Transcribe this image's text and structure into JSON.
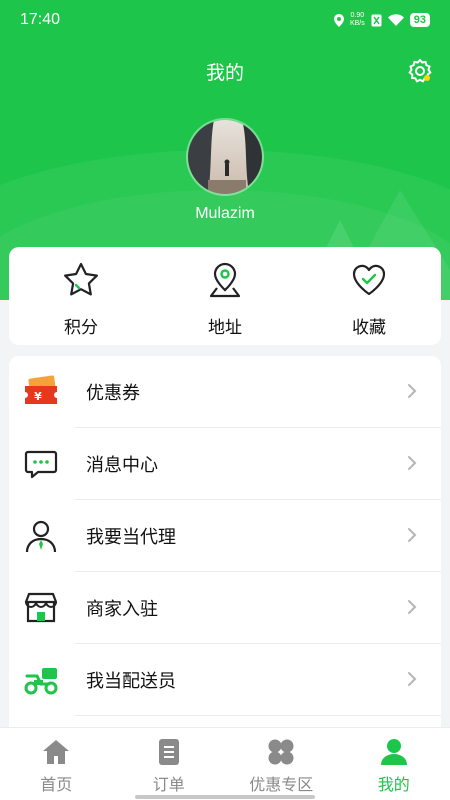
{
  "status_bar": {
    "time": "17:40",
    "net_speed_value": "0.90",
    "net_speed_unit": "KB/s",
    "battery": "93"
  },
  "header": {
    "title": "我的",
    "username": "Mulazim"
  },
  "quick_actions": [
    {
      "label": "积分",
      "icon": "star-icon"
    },
    {
      "label": "地址",
      "icon": "location-pin-icon"
    },
    {
      "label": "收藏",
      "icon": "heart-icon"
    }
  ],
  "menu": [
    {
      "label": "优惠券",
      "icon": "coupon-icon"
    },
    {
      "label": "消息中心",
      "icon": "message-icon"
    },
    {
      "label": "我要当代理",
      "icon": "agent-icon"
    },
    {
      "label": "商家入驻",
      "icon": "store-icon"
    },
    {
      "label": "我当配送员",
      "icon": "delivery-scooter-icon"
    }
  ],
  "tabbar": [
    {
      "label": "首页",
      "icon": "home-icon"
    },
    {
      "label": "订单",
      "icon": "order-icon"
    },
    {
      "label": "优惠专区",
      "icon": "discount-zone-icon"
    },
    {
      "label": "我的",
      "icon": "profile-icon",
      "active": true
    }
  ],
  "colors": {
    "brand": "#1dc64a",
    "brand_dark": "#18953a",
    "coupon_red": "#e8371f",
    "inactive": "#8a8a8a"
  }
}
